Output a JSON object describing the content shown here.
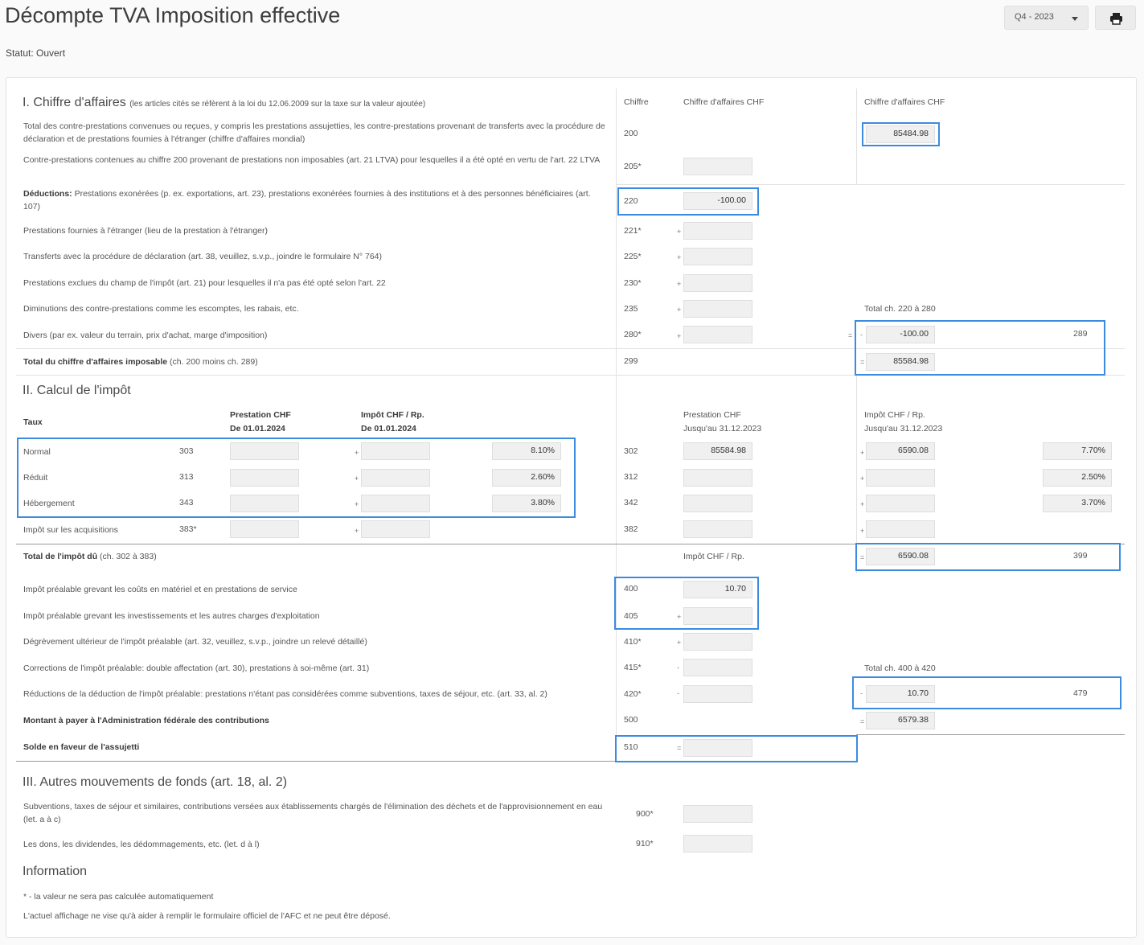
{
  "page": {
    "title": "Décompte TVA Imposition effective",
    "status": "Statut: Ouvert"
  },
  "toolbar": {
    "period": "Q4 - 2023",
    "period_icon": "caret-down-icon",
    "print_icon": "printer-icon"
  },
  "s1": {
    "title": "I. Chiffre d'affaires",
    "note": "(les articles cités se réfèrent à la loi du 12.06.2009 sur la taxe sur la valeur ajoutée)",
    "hdr_chiffre": "Chiffre",
    "hdr_ca": "Chiffre d'affaires CHF",
    "hdr_ca2": "Chiffre d'affaires CHF",
    "r200": {
      "label": "Total des contre-prestations convenues ou reçues, y compris les prestations assujetties, les contre-prestations provenant de transferts avec la procédure de déclaration et de prestations fournies à l'étranger (chiffre d'affaires mondial)",
      "code": "200",
      "value": "85484.98"
    },
    "r205": {
      "label": "Contre-prestations contenues au chiffre 200 provenant de prestations non imposables (art. 21 LTVA) pour lesquelles il a été opté en vertu de l'art. 22 LTVA",
      "code": "205*",
      "value": ""
    },
    "r220": {
      "label_bold": "Déductions:",
      "label": " Prestations exonérées (p. ex. exportations, art. 23), prestations exonérées fournies à des institutions et à des personnes bénéficiaires (art. 107)",
      "code": "220",
      "value": "-100.00"
    },
    "r221": {
      "label": "Prestations fournies à l'étranger (lieu de la prestation à l'étranger)",
      "code": "221*",
      "sign": "+",
      "value": ""
    },
    "r225": {
      "label": "Transferts avec la procédure de déclaration (art. 38, veuillez, s.v.p., joindre le formulaire N° 764)",
      "code": "225*",
      "sign": "+",
      "value": ""
    },
    "r230": {
      "label": "Prestations exclues du champ de l'impôt (art. 21) pour lesquelles il n'a pas été opté selon l'art. 22",
      "code": "230*",
      "sign": "+",
      "value": ""
    },
    "r235": {
      "label": "Diminutions des contre-prestations comme les escomptes, les rabais, etc.",
      "code": "235",
      "sign": "+",
      "value": "",
      "total_label": "Total ch. 220 à 280"
    },
    "r280": {
      "label": "Divers (par ex. valeur du terrain, prix d'achat, marge d'imposition)",
      "code": "280*",
      "sign": "+",
      "value": "",
      "eq": "=",
      "minus": "-",
      "total_value": "-100.00",
      "total_code": "289"
    },
    "r299": {
      "label_bold": "Total du chiffre d'affaires imposable",
      "label": " (ch. 200 moins ch. 289)",
      "code": "299",
      "eq": "=",
      "value": "85584.98"
    }
  },
  "s2": {
    "title": "II. Calcul de l'impôt",
    "taux": "Taux",
    "hdr_prest_new": "Prestation CHF",
    "hdr_prest_new_date": "De 01.01.2024",
    "hdr_imp_new": "Impôt CHF / Rp.",
    "hdr_imp_new_date": "De 01.01.2024",
    "hdr_prest_old": "Prestation CHF",
    "hdr_prest_old_date": "Jusqu'au 31.12.2023",
    "hdr_imp_old": "Impôt CHF / Rp.",
    "hdr_imp_old_date": "Jusqu'au 31.12.2023",
    "plus": "+",
    "normal": {
      "label": "Normal",
      "code": "303",
      "rate_new": "8.10%",
      "code_old": "302",
      "prest_old": "85584.98",
      "imp_old": "6590.08",
      "rate_old": "7.70%"
    },
    "reduit": {
      "label": "Réduit",
      "code": "313",
      "rate_new": "2.60%",
      "code_old": "312",
      "prest_old": "",
      "imp_old": "",
      "rate_old": "2.50%"
    },
    "hebergement": {
      "label": "Hébergement",
      "code": "343",
      "rate_new": "3.80%",
      "code_old": "342",
      "prest_old": "",
      "imp_old": "",
      "rate_old": "3.70%"
    },
    "acquisitions": {
      "label": "Impôt sur les acquisitions",
      "code": "383*",
      "code_old": "382"
    },
    "total": {
      "label_bold": "Total de l'impôt dû",
      "label": " (ch. 302 à 383)",
      "hdr": "Impôt CHF / Rp.",
      "eq": "=",
      "value": "6590.08",
      "code": "399"
    },
    "r400": {
      "label": "Impôt préalable grevant les coûts en matériel et en prestations de service",
      "code": "400",
      "value": "10.70"
    },
    "r405": {
      "label": "Impôt préalable grevant les investissements et les autres charges d'exploitation",
      "code": "405",
      "sign": "+"
    },
    "r410": {
      "label": "Dégrèvement ultérieur de l'impôt préalable (art. 32, veuillez, s.v.p., joindre un relevé détaillé)",
      "code": "410*",
      "sign": "+"
    },
    "r415": {
      "label": "Corrections de l'impôt préalable: double affectation (art. 30), prestations à soi-même (art. 31)",
      "code": "415*",
      "sign": "-",
      "total_label": "Total ch. 400 à 420"
    },
    "r420": {
      "label": "Réductions de la déduction de l'impôt préalable: prestations n'étant pas considérées comme subventions, taxes de séjour, etc. (art. 33, al. 2)",
      "code": "420*",
      "sign": "-",
      "minus": "-",
      "total_value": "10.70",
      "total_code": "479"
    },
    "r500": {
      "label_bold": "Montant à payer à l'Administration fédérale des contributions",
      "code": "500",
      "eq": "=",
      "value": "6579.38"
    },
    "r510": {
      "label_bold": "Solde en faveur de l'assujetti",
      "code": "510",
      "eq": "=",
      "value": ""
    }
  },
  "s3": {
    "title": "III. Autres mouvements de fonds (art. 18, al. 2)",
    "r900": {
      "label": "Subventions, taxes de séjour et similaires, contributions versées aux établissements chargés de l'élimination des déchets et de l'approvisionnement en eau (let. a à c)",
      "code": "900*"
    },
    "r910": {
      "label": "Les dons, les dividendes, les dédommagements, etc. (let. d à l)",
      "code": "910*"
    }
  },
  "info": {
    "title": "Information",
    "note1": "* - la valeur ne sera pas calculée automatiquement",
    "note2": "L'actuel affichage ne vise qu'à aider à remplir le formulaire officiel de l'AFC et ne peut être déposé."
  }
}
